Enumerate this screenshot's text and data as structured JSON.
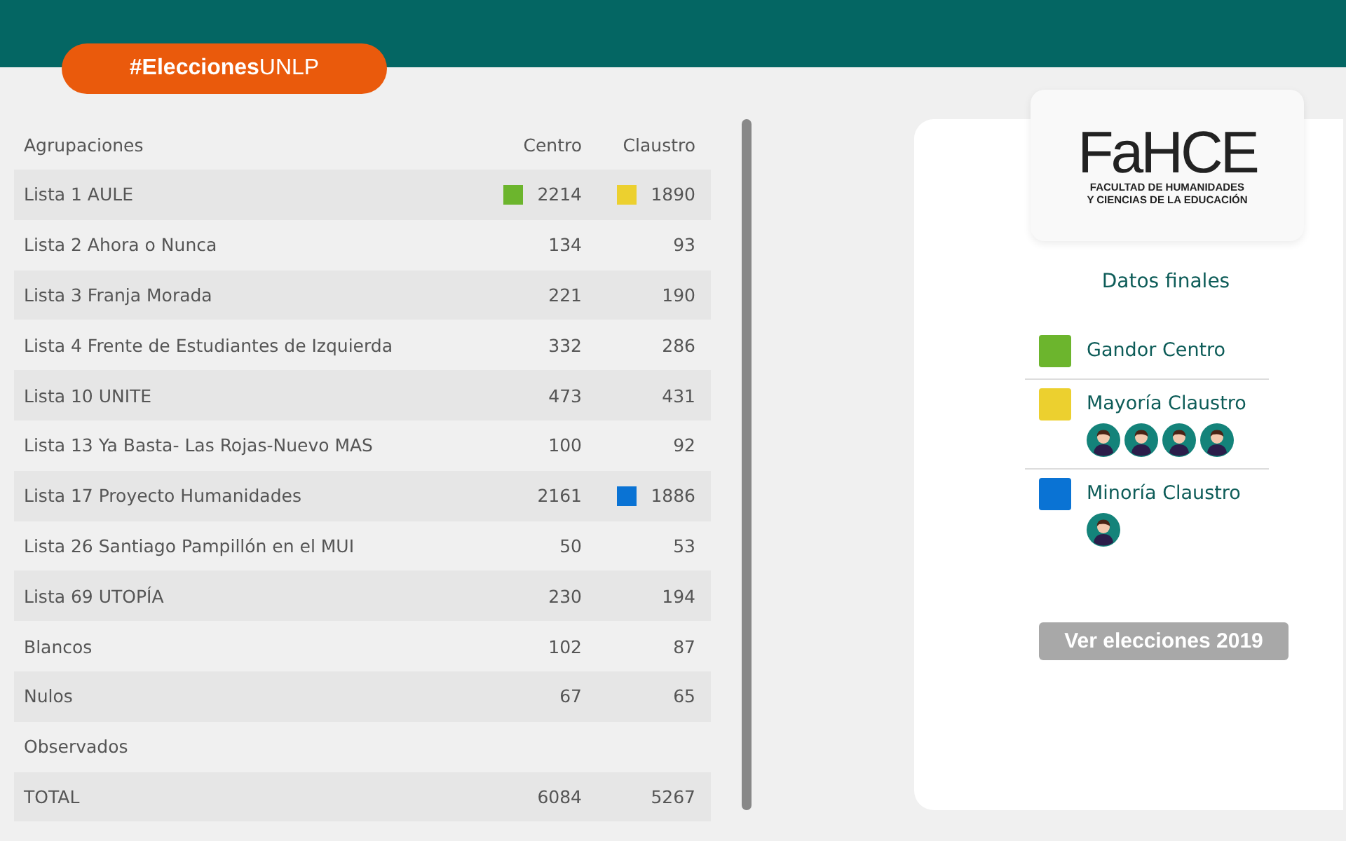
{
  "hashtag": "**#Elecciones**UNLP",
  "table": {
    "columns": [
      "Agrupaciones",
      "Centro",
      "Claustro"
    ],
    "rows": [
      {
        "name": "Lista 1 AULE",
        "centro": {
          "text": "2214",
          "color": "#6cb52d"
        },
        "claustro": {
          "text": "1890",
          "color": "#ecd02f"
        }
      },
      {
        "name": "Lista 2 Ahora o Nunca",
        "centro": {
          "text": "134"
        },
        "claustro": {
          "text": "93"
        }
      },
      {
        "name": "Lista 3 Franja Morada",
        "centro": {
          "text": "221"
        },
        "claustro": {
          "text": "190"
        }
      },
      {
        "name": "Lista 4 Frente de Estudiantes de Izquierda",
        "centro": {
          "text": "332"
        },
        "claustro": {
          "text": "286"
        }
      },
      {
        "name": "Lista 10 UNITE",
        "centro": {
          "text": "473"
        },
        "claustro": {
          "text": "431"
        }
      },
      {
        "name": "Lista 13 Ya Basta- Las Rojas-Nuevo MAS",
        "centro": {
          "text": "100"
        },
        "claustro": {
          "text": "92"
        }
      },
      {
        "name": "Lista 17 Proyecto Humanidades",
        "centro": {
          "text": "2161"
        },
        "claustro": {
          "text": "1886",
          "color": "#0a73d4"
        }
      },
      {
        "name": "Lista 26 Santiago Pampillón en el MUI",
        "centro": {
          "text": "50"
        },
        "claustro": {
          "text": "53"
        }
      },
      {
        "name": "Lista 69 UTOPÍA",
        "centro": {
          "text": "230"
        },
        "claustro": {
          "text": "194"
        }
      },
      {
        "name": "Blancos",
        "centro": {
          "text": "102"
        },
        "claustro": {
          "text": "87"
        }
      },
      {
        "name": "Nulos",
        "centro": {
          "text": "67"
        },
        "claustro": {
          "text": "65"
        }
      },
      {
        "name": "Observados"
      },
      {
        "name": "TOTAL",
        "centro": {
          "text": "6084"
        },
        "claustro": {
          "text": "5267"
        }
      }
    ]
  },
  "logo": {
    "title": "FaHCE",
    "subtitle_1": "FACULTAD DE HUMANIDADES",
    "subtitle_2": "Y CIENCIAS DE LA EDUCACIÓN"
  },
  "summary": {
    "title": "Datos finales",
    "legend": [
      {
        "label": "Gandor Centro",
        "color": "#6cb52d"
      },
      {
        "label": "Mayoría Claustro",
        "color": "#ecd02f",
        "avatars": [
          {
            "kind": "avatar"
          },
          {
            "kind": "avatar"
          },
          {
            "kind": "avatar"
          },
          {
            "kind": "avatar"
          }
        ]
      },
      {
        "label": "Minoría Claustro",
        "color": "#0a73d4",
        "avatars": [
          {
            "kind": "avatar"
          }
        ]
      }
    ]
  },
  "button": "Ver elecciones 2019"
}
